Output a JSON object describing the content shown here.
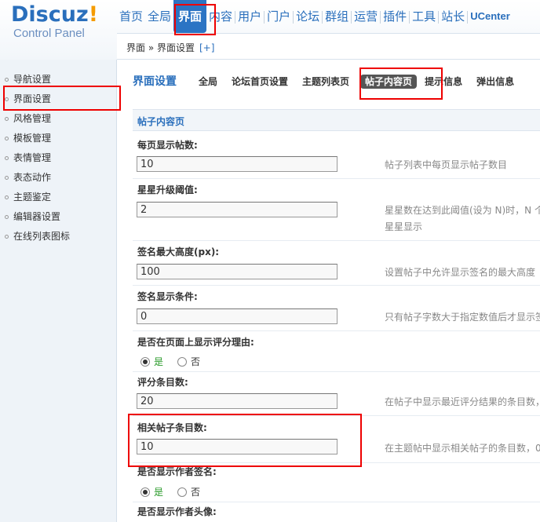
{
  "header": {
    "logo_text": "Discuz",
    "logo_bang": "!",
    "logo_sub": "Control Panel",
    "nav": [
      "首页",
      "全局",
      "界面",
      "内容",
      "用户",
      "门户",
      "论坛",
      "群组",
      "运营",
      "插件",
      "工具",
      "站长",
      "UCenter"
    ],
    "active_nav": "界面"
  },
  "breadcrumb": {
    "text": "界面 » 界面设置",
    "add_label": "[+]"
  },
  "sidebar": {
    "items": [
      {
        "label": "导航设置"
      },
      {
        "label": "界面设置"
      },
      {
        "label": "风格管理"
      },
      {
        "label": "模板管理"
      },
      {
        "label": "表情管理"
      },
      {
        "label": "表态动作"
      },
      {
        "label": "主题鉴定"
      },
      {
        "label": "编辑器设置"
      },
      {
        "label": "在线列表图标"
      }
    ],
    "active": "界面设置"
  },
  "tabs": {
    "title": "界面设置",
    "items": [
      "全局",
      "论坛首页设置",
      "主题列表页",
      "帖子内容页",
      "提示信息",
      "弹出信息"
    ],
    "active": "帖子内容页"
  },
  "section": {
    "title": "帖子内容页"
  },
  "fields": [
    {
      "label": "每页显示帖数:",
      "value": "10",
      "tip": "帖子列表中每页显示帖子数目"
    },
    {
      "label": "星星升级阈值:",
      "value": "2",
      "tip": "星星数在达到此阈值(设为 N)时，N 个",
      "tip2": "星星显示"
    },
    {
      "label": "签名最大高度(px):",
      "value": "100",
      "tip": "设置帖子中允许显示签名的最大高度"
    },
    {
      "label": "签名显示条件:",
      "value": "0",
      "tip": "只有帖子字数大于指定数值后才显示签"
    },
    {
      "label": "评分条目数:",
      "value": "20",
      "tip": "在帖子中显示最近评分结果的条目数，"
    },
    {
      "label": "相关帖子条目数:",
      "value": "10",
      "tip": "在主题帖中显示相关帖子的条目数，0"
    }
  ],
  "radios": [
    {
      "label": "是否在页面上显示评分理由:",
      "yes": "是",
      "no": "否",
      "selected": "是"
    },
    {
      "label": "是否显示作者签名:",
      "yes": "是",
      "no": "否",
      "selected": "是"
    }
  ],
  "last_label": "是否显示作者头像:"
}
